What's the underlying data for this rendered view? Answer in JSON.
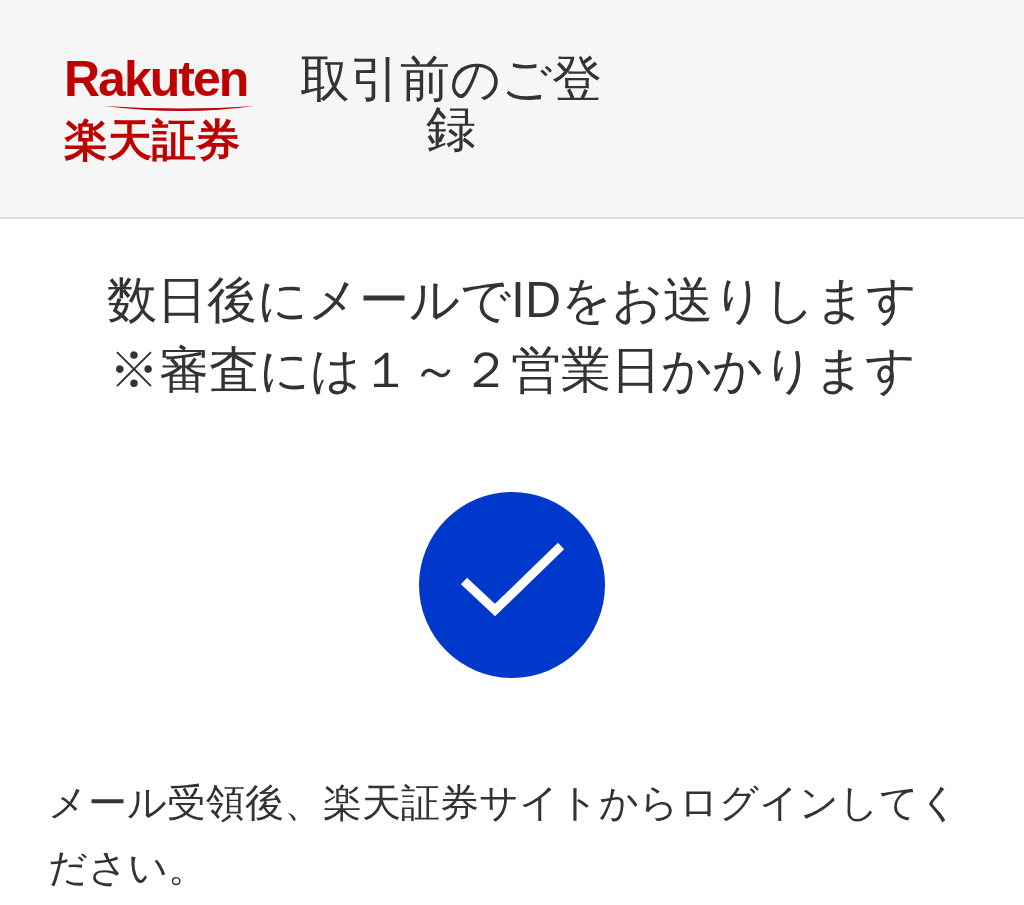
{
  "header": {
    "logo": {
      "wordmark": "Rakuten",
      "name": "楽天証券"
    },
    "title": "取引前のご登録"
  },
  "message": {
    "lines": [
      "数日後にメールでIDをお送りします",
      "※審査には１～２営業日かかります"
    ]
  },
  "note": "メール受領後、楽天証券サイトからログインしてください。"
}
